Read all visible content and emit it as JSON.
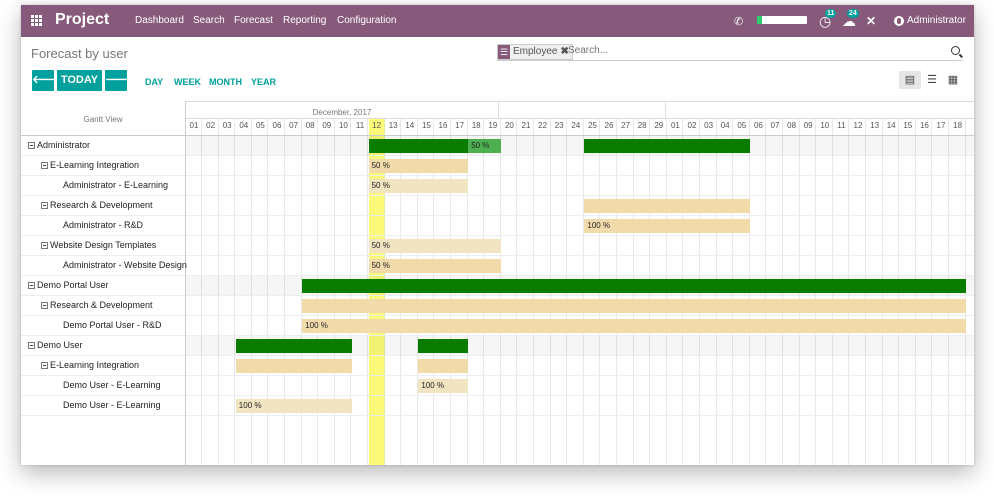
{
  "navbar": {
    "app_title": "Project",
    "menu": [
      "Dashboard",
      "Search",
      "Forecast",
      "Reporting",
      "Configuration"
    ],
    "phone_icon": "phone-icon",
    "progress": 0.1,
    "progress_color": "#2ecc71",
    "activities_badge": "11",
    "messages_badge": "24",
    "user_name": "Administrator",
    "bg_color": "#875a7b"
  },
  "control": {
    "title": "Forecast by user",
    "facet_label": "Employee",
    "facet_remove": "✖",
    "search_placeholder": "Search...",
    "prev_label": "🡐",
    "today_label": "TODAY",
    "next_label": "🡒",
    "scales": [
      "DAY",
      "WEEK",
      "MONTH",
      "YEAR"
    ],
    "views": [
      "gantt-view",
      "list-view",
      "grid-view"
    ],
    "accent_color": "#00a09d"
  },
  "gantt": {
    "view_label": "Gantt View",
    "month_label": "December, 2017",
    "days": [
      "01",
      "02",
      "03",
      "04",
      "05",
      "06",
      "07",
      "08",
      "09",
      "10",
      "11",
      "12",
      "13",
      "14",
      "15",
      "16",
      "17",
      "18",
      "19",
      "20",
      "21",
      "22",
      "23",
      "24",
      "25",
      "26",
      "27",
      "28",
      "29",
      "01",
      "02",
      "03",
      "04",
      "05",
      "06",
      "07",
      "08",
      "09",
      "10",
      "11",
      "12",
      "13",
      "14",
      "15",
      "16",
      "17",
      "18"
    ],
    "today_index": 11,
    "rows": [
      {
        "label": "Administrator",
        "level": 0,
        "toggle": true,
        "group": true,
        "bars": [
          {
            "start": 11,
            "end": 16,
            "color": "green",
            "label": ""
          },
          {
            "start": 17,
            "end": 18,
            "color": "lightgreen",
            "label": "50 %"
          },
          {
            "start": 24,
            "end": 33,
            "color": "green",
            "label": ""
          }
        ]
      },
      {
        "label": "E-Learning Integration",
        "level": 1,
        "toggle": true,
        "group": false,
        "bars": [
          {
            "start": 11,
            "end": 16,
            "color": "orange",
            "label": "50 %"
          }
        ]
      },
      {
        "label": "Administrator - E-Learning",
        "level": 2,
        "toggle": false,
        "group": false,
        "bars": [
          {
            "start": 11,
            "end": 16,
            "color": "pale",
            "label": "50 %"
          }
        ]
      },
      {
        "label": "Research & Development",
        "level": 1,
        "toggle": true,
        "group": false,
        "bars": [
          {
            "start": 24,
            "end": 33,
            "color": "orange",
            "label": ""
          }
        ]
      },
      {
        "label": "Administrator - R&D",
        "level": 2,
        "toggle": false,
        "group": false,
        "bars": [
          {
            "start": 24,
            "end": 33,
            "color": "orange",
            "label": "100 %"
          }
        ]
      },
      {
        "label": "Website Design Templates",
        "level": 1,
        "toggle": true,
        "group": false,
        "bars": [
          {
            "start": 11,
            "end": 18,
            "color": "pale",
            "label": "50 %"
          }
        ]
      },
      {
        "label": "Administrator - Website Design",
        "level": 2,
        "toggle": false,
        "group": false,
        "bars": [
          {
            "start": 11,
            "end": 18,
            "color": "orange",
            "label": "50 %"
          }
        ]
      },
      {
        "label": "Demo Portal User",
        "level": 0,
        "toggle": true,
        "group": true,
        "bars": [
          {
            "start": 7,
            "end": 46,
            "color": "green",
            "label": ""
          }
        ]
      },
      {
        "label": "Research & Development",
        "level": 1,
        "toggle": true,
        "group": false,
        "bars": [
          {
            "start": 7,
            "end": 46,
            "color": "orange",
            "label": ""
          }
        ]
      },
      {
        "label": "Demo Portal User - R&D",
        "level": 2,
        "toggle": false,
        "group": false,
        "bars": [
          {
            "start": 7,
            "end": 46,
            "color": "orange",
            "label": "100 %"
          }
        ]
      },
      {
        "label": "Demo User",
        "level": 0,
        "toggle": true,
        "group": true,
        "bars": [
          {
            "start": 3,
            "end": 9,
            "color": "green",
            "label": ""
          },
          {
            "start": 14,
            "end": 16,
            "color": "green",
            "label": ""
          }
        ]
      },
      {
        "label": "E-Learning Integration",
        "level": 1,
        "toggle": true,
        "group": false,
        "bars": [
          {
            "start": 3,
            "end": 9,
            "color": "orange",
            "label": ""
          },
          {
            "start": 14,
            "end": 16,
            "color": "orange",
            "label": ""
          }
        ]
      },
      {
        "label": "Demo User - E-Learning",
        "level": 2,
        "toggle": false,
        "group": false,
        "bars": [
          {
            "start": 14,
            "end": 16,
            "color": "pale",
            "label": "100 %"
          }
        ]
      },
      {
        "label": "Demo User - E-Learning",
        "level": 2,
        "toggle": false,
        "group": false,
        "bars": [
          {
            "start": 3,
            "end": 9,
            "color": "pale",
            "label": "100 %"
          }
        ]
      }
    ]
  }
}
